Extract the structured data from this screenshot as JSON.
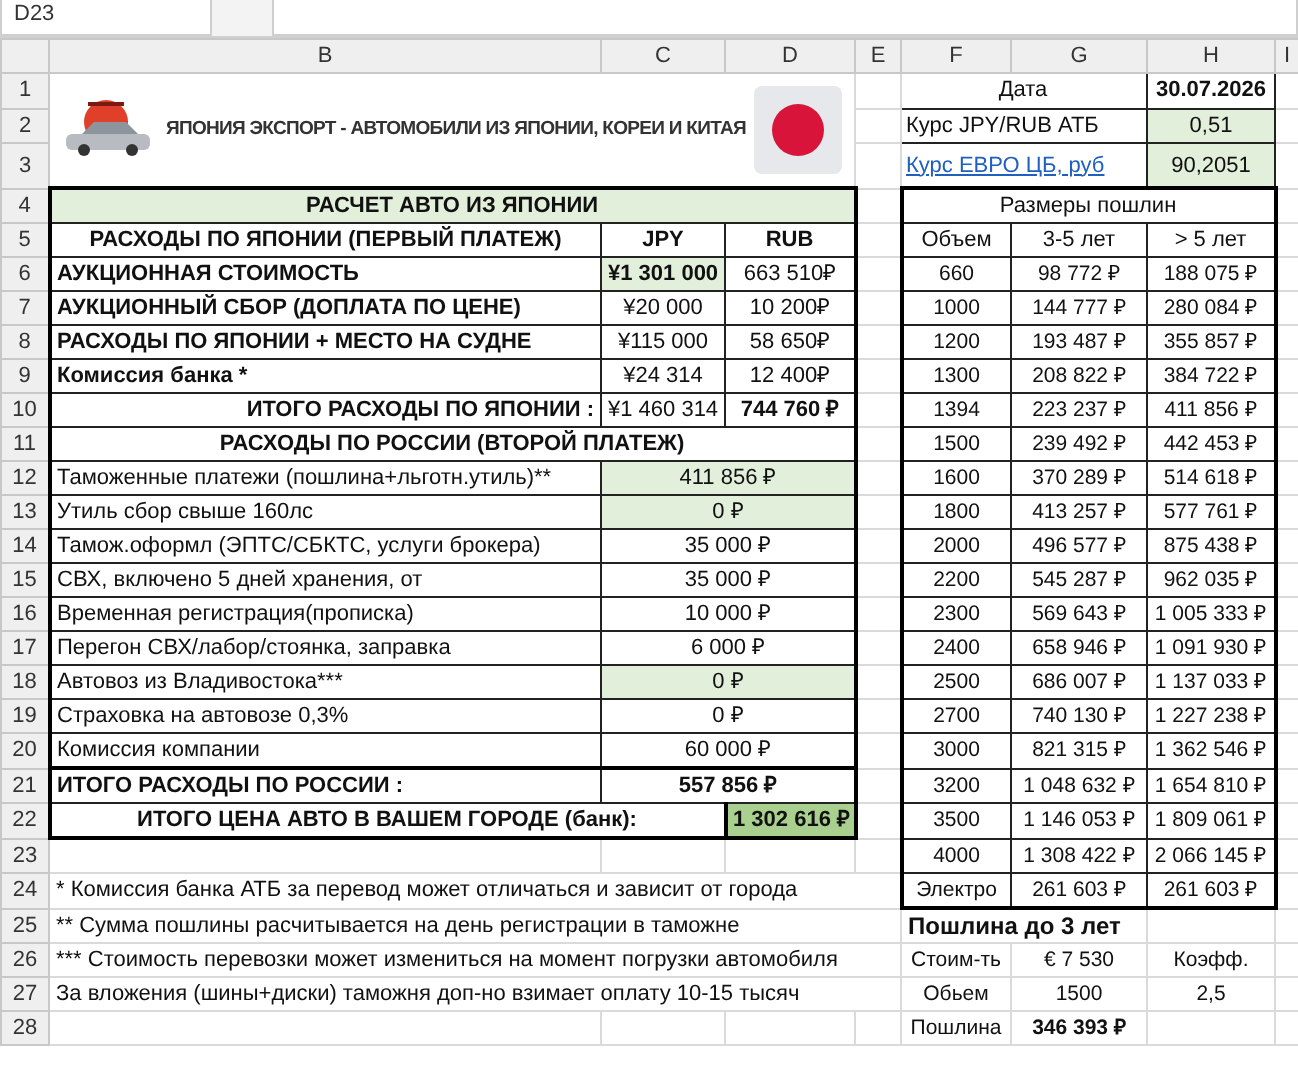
{
  "formula_bar": {
    "name_box": "D23"
  },
  "column_headers": [
    "B",
    "C",
    "D",
    "E",
    "F",
    "G",
    "H",
    "I"
  ],
  "row_numbers": [
    "1",
    "2",
    "3",
    "4",
    "5",
    "6",
    "7",
    "8",
    "9",
    "10",
    "11",
    "12",
    "13",
    "14",
    "15",
    "16",
    "17",
    "18",
    "19",
    "20",
    "21",
    "22",
    "23",
    "24",
    "25",
    "26",
    "27",
    "28"
  ],
  "header": {
    "title": "ЯПОНИЯ  ЭКСПОРТ - АВТОМОБИЛИ ИЗ ЯПОНИИ, КОРЕИ И КИТАЯ"
  },
  "rates": [
    {
      "kind": "date",
      "label": "Дата",
      "value": "30.07.2026"
    },
    {
      "kind": "input",
      "label": "Курс JPY/RUB АТБ",
      "value": "0,51"
    },
    {
      "kind": "link",
      "label": "Курс ЕВРО ЦБ, руб",
      "value": "90,2051"
    }
  ],
  "calc": {
    "title": "РАСЧЕТ АВТО ИЗ ЯПОНИИ",
    "japan": {
      "columns": [
        "РАСХОДЫ ПО ЯПОНИИ (ПЕРВЫЙ ПЛАТЕЖ)",
        "JPY",
        "RUB"
      ],
      "rows": [
        {
          "label": "АУКЦИОННАЯ СТОИМОСТЬ",
          "jpy": "¥1 301 000",
          "rub": "663 510₽",
          "highlighted": true
        },
        {
          "label": "АУКЦИОННЫЙ СБОР (ДОПЛАТА ПО ЦЕНЕ)",
          "jpy": "¥20 000",
          "rub": "10 200₽",
          "highlighted": false
        },
        {
          "label": "РАСХОДЫ ПО ЯПОНИИ + МЕСТО НА СУДНЕ",
          "jpy": "¥115 000",
          "rub": "58 650₽",
          "highlighted": false
        },
        {
          "label": "Комиссия банка *",
          "jpy": "¥24 314",
          "rub": "12 400₽",
          "highlighted": false
        }
      ],
      "total": {
        "label": "ИТОГО РАСХОДЫ ПО ЯПОНИИ :",
        "jpy": "¥1 460 314",
        "rub": "744 760 ₽"
      }
    },
    "russia": {
      "title": "РАСХОДЫ ПО РОССИИ (ВТОРОЙ ПЛАТЕЖ)",
      "rows": [
        {
          "label": "Таможенные платежи (пошлина+льготн.утиль)**",
          "value": "411 856 ₽",
          "highlighted": true
        },
        {
          "label": "Утиль сбор свыше 160лс",
          "value": "0 ₽",
          "highlighted": true
        },
        {
          "label": "Тамож.оформл (ЭПТС/СБКТС, услуги брокера)",
          "value": "35 000 ₽",
          "highlighted": false
        },
        {
          "label": "СВХ, включено 5 дней хранения, от",
          "value": "35 000 ₽",
          "highlighted": false
        },
        {
          "label": "Временная регистрация(прописка)",
          "value": "10 000 ₽",
          "highlighted": false
        },
        {
          "label": "Перегон СВХ/лабор/стоянка, заправка",
          "value": "6 000 ₽",
          "highlighted": false
        },
        {
          "label": "Автовоз из Владивостока***",
          "value": "0 ₽",
          "highlighted": true
        },
        {
          "label": "Страховка на автовозе 0,3%",
          "value": "0 ₽",
          "highlighted": false
        },
        {
          "label": "Комиссия компании",
          "value": "60 000 ₽",
          "highlighted": false
        }
      ],
      "total": {
        "label": "ИТОГО РАСХОДЫ ПО РОССИИ :",
        "value": "557 856 ₽"
      }
    },
    "final": {
      "label": "ИТОГО ЦЕНА АВТО В ВАШЕМ ГОРОДЕ (банк):",
      "value": "1 302 616 ₽"
    }
  },
  "notes": [
    "* Комиссия банка АТБ за перевод может отличаться и зависит от города",
    "** Сумма пошлины расчитывается на день регистрации в таможне",
    "*** Стоимость перевозки может измениться на момент погрузки автомобиля",
    "За вложения (шины+диски) таможня доп-но взимает оплату 10-15 тысяч"
  ],
  "duties": {
    "title": "Размеры пошлин",
    "columns": [
      "Объем",
      "3-5 лет",
      "> 5 лет"
    ],
    "rows": [
      [
        "660",
        "98 772 ₽",
        "188 075 ₽"
      ],
      [
        "1000",
        "144 777 ₽",
        "280 084 ₽"
      ],
      [
        "1200",
        "193 487 ₽",
        "355 857 ₽"
      ],
      [
        "1300",
        "208 822 ₽",
        "384 722 ₽"
      ],
      [
        "1394",
        "223 237 ₽",
        "411 856 ₽"
      ],
      [
        "1500",
        "239 492 ₽",
        "442 453 ₽"
      ],
      [
        "1600",
        "370 289 ₽",
        "514 618 ₽"
      ],
      [
        "1800",
        "413 257 ₽",
        "577 761 ₽"
      ],
      [
        "2000",
        "496 577 ₽",
        "875 438 ₽"
      ],
      [
        "2200",
        "545 287 ₽",
        "962 035 ₽"
      ],
      [
        "2300",
        "569 643 ₽",
        "1 005 333 ₽"
      ],
      [
        "2400",
        "658 946 ₽",
        "1 091 930 ₽"
      ],
      [
        "2500",
        "686 007 ₽",
        "1 137 033 ₽"
      ],
      [
        "2700",
        "740 130 ₽",
        "1 227 238 ₽"
      ],
      [
        "3000",
        "821 315 ₽",
        "1 362 546 ₽"
      ],
      [
        "3200",
        "1 048 632 ₽",
        "1 654 810 ₽"
      ],
      [
        "3500",
        "1 146 053 ₽",
        "1 809 061 ₽"
      ],
      [
        "4000",
        "1 308 422 ₽",
        "2 066 145 ₽"
      ],
      [
        "Электро",
        "261 603 ₽",
        "261 603 ₽"
      ]
    ]
  },
  "duty_under_3": {
    "title": "Пошлина до 3 лет",
    "rows": [
      [
        "Стоим-ть",
        "€ 7 530",
        "Коэфф."
      ],
      [
        "Обьем",
        "1500",
        "2,5"
      ],
      [
        "Пошлина",
        "346 393 ₽"
      ]
    ]
  }
}
